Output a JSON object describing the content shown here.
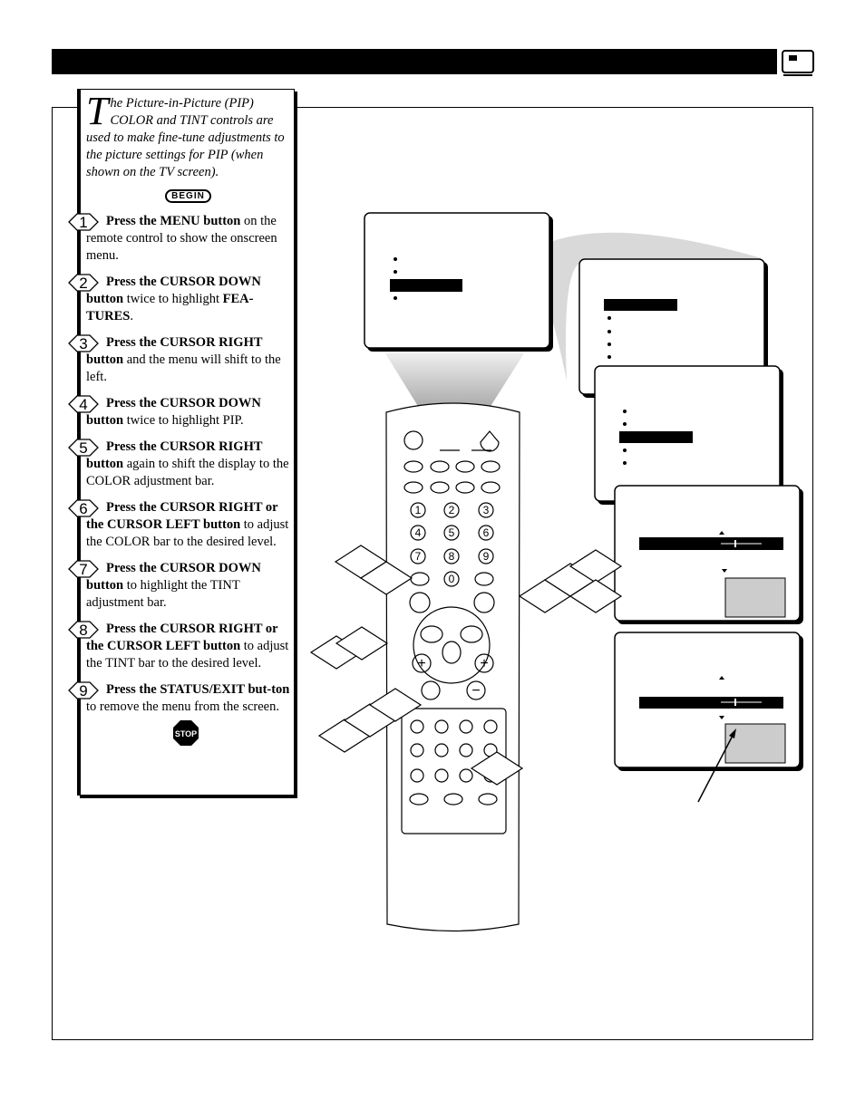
{
  "intro": {
    "drop_cap": "T",
    "text": "he Picture-in-Picture (PIP) COLOR and TINT controls are used to make fine-tune adjustments to the picture settings for PIP (when shown on the TV screen)."
  },
  "begin_label": "BEGIN",
  "stop_label": "STOP",
  "steps": [
    {
      "num": "1",
      "bold": "Press the MENU button",
      "rest": " on the remote control to show the onscreen menu."
    },
    {
      "num": "2",
      "bold": "Press the CURSOR DOWN button",
      "rest": " twice to highlight ",
      "bold2": "FEA-TURES",
      "rest2": "."
    },
    {
      "num": "3",
      "bold": "Press the CURSOR RIGHT button",
      "rest": " and the menu will shift to the left."
    },
    {
      "num": "4",
      "bold": "Press the CURSOR DOWN button",
      "rest": " twice to highlight PIP."
    },
    {
      "num": "5",
      "bold": "Press the CURSOR RIGHT button",
      "rest": " again to shift the display to the COLOR adjustment bar."
    },
    {
      "num": "6",
      "bold": "Press the CURSOR RIGHT or the CURSOR LEFT button",
      "rest": " to adjust the COLOR bar to the desired level."
    },
    {
      "num": "7",
      "bold": "Press the CURSOR DOWN button",
      "rest": " to highlight the TINT adjustment bar."
    },
    {
      "num": "8",
      "bold": "Press the CURSOR RIGHT or the CURSOR LEFT button",
      "rest": " to adjust the TINT bar to the desired level."
    },
    {
      "num": "9",
      "bold": "Press the STATUS/EXIT but-ton",
      "rest": " to remove the menu from the screen."
    }
  ],
  "remote_keys": [
    "1",
    "2",
    "3",
    "4",
    "5",
    "6",
    "7",
    "8",
    "9",
    "0",
    "+",
    "+",
    "−"
  ],
  "colors": {
    "ink": "#000000",
    "shade": "#d9d9d9",
    "pip_window": "#cccccc"
  }
}
